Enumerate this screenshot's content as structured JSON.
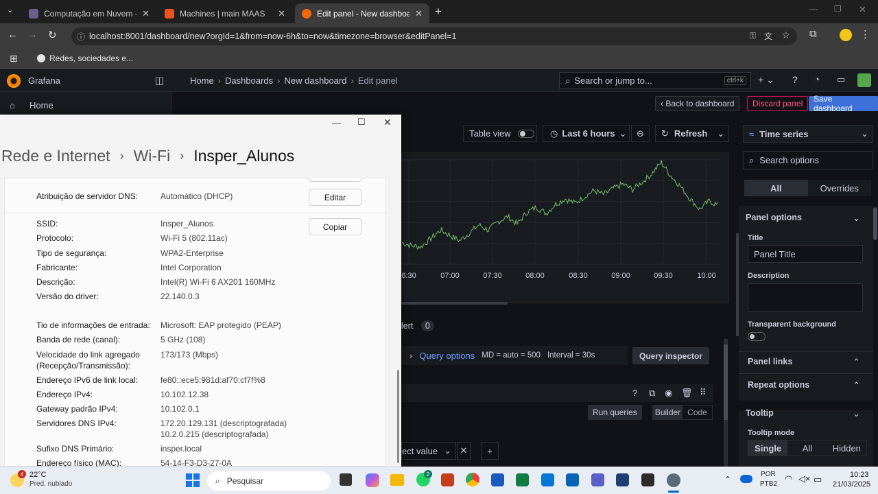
{
  "browser": {
    "tabs": [
      {
        "title": "Computação em Nuvem - Com",
        "color": "#6b5d8c"
      },
      {
        "title": "Machines | main MAAS",
        "color": "#e95420"
      },
      {
        "title": "Edit panel - New dashboard - D",
        "color": "#f46800"
      }
    ],
    "url": "localhost:8001/dashboard/new?orgId=1&from=now-6h&to=now&timezone=browser&editPanel=1",
    "bookmark": "Redes, sociedades e..."
  },
  "grafana": {
    "brand": "Grafana",
    "breadcrumb": [
      "Home",
      "Dashboards",
      "New dashboard",
      "Edit panel"
    ],
    "search_placeholder": "Search or jump to...",
    "search_shortcut": "ctrl+k",
    "side_home": "Home",
    "back_btn": "Back to dashboard",
    "discard_btn": "Discard panel",
    "save_btn": "Save dashboard",
    "table_view": "Table view",
    "time_range": "Last 6 hours",
    "refresh": "Refresh",
    "viz_type": "Time series",
    "search_options": "Search options",
    "tab_all": "All",
    "tab_overrides": "Overrides",
    "panel_options": "Panel options",
    "title_label": "Title",
    "title_value": "Panel Title",
    "description_label": "Description",
    "transparent_label": "Transparent background",
    "panel_links": "Panel links",
    "repeat_options": "Repeat options",
    "tooltip": "Tooltip",
    "tooltip_mode": "Tooltip mode",
    "tooltip_modes": [
      "Single",
      "All",
      "Hidden"
    ],
    "alert_tab": "lert",
    "alert_count": "0",
    "query_options": "Query options",
    "query_md": "MD = auto = 500",
    "query_interval": "Interval = 30s",
    "query_inspector": "Query inspector",
    "run_queries": "Run queries",
    "builder": "Builder",
    "code": "Code",
    "select_value": "ect value"
  },
  "chart_data": {
    "type": "line",
    "x_ticks": [
      "6:30",
      "07:00",
      "07:30",
      "08:00",
      "08:30",
      "09:00",
      "09:30",
      "10:00"
    ],
    "series": [
      {
        "values": [
          0.18,
          0.15,
          0.14,
          0.22,
          0.3,
          0.25,
          0.2,
          0.27,
          0.35,
          0.3,
          0.38,
          0.43,
          0.36,
          0.47,
          0.52,
          0.46,
          0.55,
          0.6,
          0.56,
          0.62,
          0.68,
          0.64,
          0.7,
          0.74,
          0.69,
          0.76,
          0.84,
          0.95,
          0.82,
          0.72,
          0.6,
          0.5,
          0.58,
          0.53
        ]
      }
    ],
    "grid": true
  },
  "settings": {
    "breadcrumb": [
      "Rede e Internet",
      "Wi-Fi",
      "Insper_Alunos"
    ],
    "rows": [
      {
        "label": "Atribuição de servidor DNS:",
        "value": "Automático (DHCP)"
      },
      {
        "label": "SSID:",
        "value": "Insper_Alunos"
      },
      {
        "label": "Protocolo:",
        "value": "Wi-Fi 5 (802.11ac)"
      },
      {
        "label": "Tipo de segurança:",
        "value": "WPA2-Enterprise"
      },
      {
        "label": "Fabricante:",
        "value": "Intel Corporation"
      },
      {
        "label": "Descrição:",
        "value": "Intel(R) Wi-Fi 6 AX201 160MHz"
      },
      {
        "label": "Versão do driver:",
        "value": "22.140.0.3"
      },
      {
        "label": "Tio de informações de entrada:",
        "value": "Microsoft: EAP protegido (PEAP)"
      },
      {
        "label": "Banda de rede (canal):",
        "value": "5 GHz (108)"
      },
      {
        "label": "Velocidade do link agregado",
        "value": "173/173 (Mbps)"
      },
      {
        "label": "(Recepção/Transmissão):",
        "value": ""
      },
      {
        "label": "Endereço IPv6 de link local:",
        "value": "fe80::ece5:981d:af70:cf7f%8"
      },
      {
        "label": "Endereço IPv4:",
        "value": "10.102.12.38"
      },
      {
        "label": "Gateway padrão IPv4:",
        "value": "10.102.0.1"
      },
      {
        "label": "Servidores DNS IPv4:",
        "value": "172.20.129.131 (descriptografada)"
      },
      {
        "label": "",
        "value": "10.2.0.215 (descriptografada)"
      },
      {
        "label": "Sufixo DNS Primário:",
        "value": "insper.local"
      },
      {
        "label": "Endereço físico (MAC):",
        "value": "54-14-F3-D3-27-0A"
      }
    ],
    "edit_btn": "Editar",
    "copy_btn": "Copiar"
  },
  "taskbar": {
    "weather_temp": "22°C",
    "weather_desc": "Pred. nublado",
    "weather_badge": "4",
    "search": "Pesquisar",
    "lang1": "POR",
    "lang2": "PTB2",
    "time": "10:23",
    "date": "21/03/2025",
    "whatsapp_badge": "2"
  }
}
